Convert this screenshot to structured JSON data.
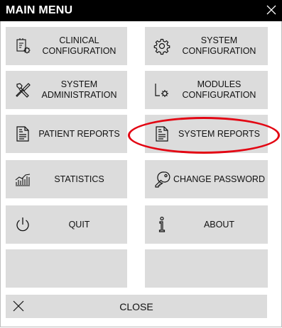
{
  "window": {
    "title": "MAIN MENU",
    "close_icon": "close-icon"
  },
  "menu": {
    "clinical_configuration": {
      "label": "CLINICAL\nCONFIGURATION",
      "icon": "clinical-config-icon"
    },
    "system_configuration": {
      "label": "SYSTEM\nCONFIGURATION",
      "icon": "gear-icon"
    },
    "system_administration": {
      "label": "SYSTEM\nADMINISTRATION",
      "icon": "tools-icon"
    },
    "modules_configuration": {
      "label": "MODULES\nCONFIGURATION",
      "icon": "module-gear-icon"
    },
    "patient_reports": {
      "label": "PATIENT REPORTS",
      "icon": "document-icon"
    },
    "system_reports": {
      "label": "SYSTEM REPORTS",
      "icon": "document-icon"
    },
    "statistics": {
      "label": "STATISTICS",
      "icon": "statistics-icon"
    },
    "change_password": {
      "label": "CHANGE PASSWORD",
      "icon": "key-icon"
    },
    "quit": {
      "label": "QUIT",
      "icon": "power-icon"
    },
    "about": {
      "label": "ABOUT",
      "icon": "info-icon"
    },
    "close": {
      "label": "CLOSE",
      "icon": "close-icon"
    }
  },
  "annotation": {
    "color": "#e30613"
  },
  "colors": {
    "title_bar": "#000000",
    "tile": "#dcdcdc"
  }
}
